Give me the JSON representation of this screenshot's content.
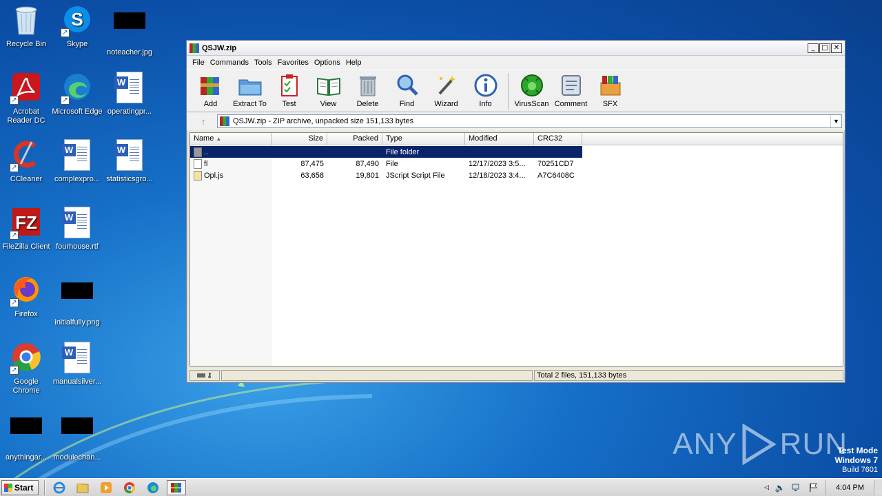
{
  "desktop": {
    "icons": [
      {
        "label": "Recycle Bin",
        "icon": "recycle-bin-icon"
      },
      {
        "label": "Skype",
        "icon": "skype-icon"
      },
      {
        "label": "noteacher.jpg",
        "icon": "image-file-icon"
      },
      {
        "label": "Acrobat Reader DC",
        "icon": "acrobat-icon"
      },
      {
        "label": "Microsoft Edge",
        "icon": "edge-icon"
      },
      {
        "label": "operatingpr...",
        "icon": "word-doc-icon"
      },
      {
        "label": "CCleaner",
        "icon": "ccleaner-icon"
      },
      {
        "label": "complexpro...",
        "icon": "word-doc-icon"
      },
      {
        "label": "statisticsgro...",
        "icon": "word-doc-icon"
      },
      {
        "label": "FileZilla Client",
        "icon": "filezilla-icon"
      },
      {
        "label": "fourhouse.rtf",
        "icon": "word-doc-icon"
      },
      {
        "label": "Firefox",
        "icon": "firefox-icon"
      },
      {
        "label": "initialfully.png",
        "icon": "image-file-icon"
      },
      {
        "label": "Google Chrome",
        "icon": "chrome-icon"
      },
      {
        "label": "manualsilver...",
        "icon": "word-doc-icon"
      },
      {
        "label": "anythingar...",
        "icon": "image-file-icon"
      },
      {
        "label": "modulechan...",
        "icon": "image-file-icon"
      }
    ]
  },
  "window": {
    "title": "QSJW.zip",
    "menu": [
      "File",
      "Commands",
      "Tools",
      "Favorites",
      "Options",
      "Help"
    ],
    "toolbar": [
      {
        "label": "Add",
        "icon": "add-archive-icon"
      },
      {
        "label": "Extract To",
        "icon": "extract-folder-icon"
      },
      {
        "label": "Test",
        "icon": "test-clipboard-icon"
      },
      {
        "label": "View",
        "icon": "view-book-icon"
      },
      {
        "label": "Delete",
        "icon": "trash-icon"
      },
      {
        "label": "Find",
        "icon": "magnifier-icon"
      },
      {
        "label": "Wizard",
        "icon": "wand-icon"
      },
      {
        "label": "Info",
        "icon": "info-icon"
      },
      {
        "label": "VirusScan",
        "icon": "virus-scan-icon"
      },
      {
        "label": "Comment",
        "icon": "comment-icon"
      },
      {
        "label": "SFX",
        "icon": "sfx-icon"
      }
    ],
    "address": "QSJW.zip - ZIP archive, unpacked size 151,133 bytes",
    "columns": [
      "Name",
      "Size",
      "Packed",
      "Type",
      "Modified",
      "CRC32"
    ],
    "rows": [
      {
        "name": "..",
        "size": "",
        "packed": "",
        "type": "File folder",
        "modified": "",
        "crc": "",
        "selected": true
      },
      {
        "name": "fl",
        "size": "87,475",
        "packed": "87,490",
        "type": "File",
        "modified": "12/17/2023 3:5...",
        "crc": "70251CD7",
        "selected": false
      },
      {
        "name": "Opl.js",
        "size": "63,658",
        "packed": "19,801",
        "type": "JScript Script File",
        "modified": "12/18/2023 3:4...",
        "crc": "A7C6408C",
        "selected": false
      }
    ],
    "status": "Total 2 files, 151,133 bytes"
  },
  "watermark": {
    "text1": "ANY",
    "text2": "RUN"
  },
  "testmode": {
    "line1": "Test Mode",
    "line2": "Windows 7",
    "line3": "Build 7601"
  },
  "taskbar": {
    "start": "Start",
    "clock": "4:04 PM"
  }
}
